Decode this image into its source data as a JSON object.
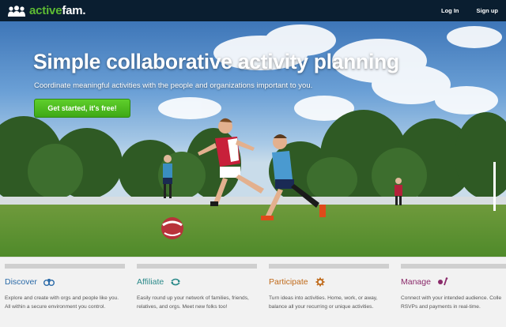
{
  "brand": {
    "name_accent": "active",
    "name_rest": "fam."
  },
  "nav": {
    "login": "Log In",
    "signup": "Sign up"
  },
  "hero": {
    "title": "Simple collaborative activity planning",
    "subtitle": "Coordinate meaningful activities with the people and organizations important to you.",
    "cta": "Get started, it's free!"
  },
  "features": [
    {
      "title": "Discover",
      "color": "#2a6aa8",
      "icon": "binoculars-icon",
      "line1": "Explore and create with orgs and people like you.",
      "line2": "All within a secure environment you control."
    },
    {
      "title": "Affiliate",
      "color": "#2c8a8a",
      "icon": "link-arrows-icon",
      "line1": "Easily round up your network of families, friends,",
      "line2": "relatives, and orgs. Meet new folks too!"
    },
    {
      "title": "Participate",
      "color": "#c06a1a",
      "icon": "gear-icon",
      "line1": "Turn ideas into activities. Home, work, or away,",
      "line2": "balance all your recurring or unique activities."
    },
    {
      "title": "Manage",
      "color": "#8a2a6a",
      "icon": "manage-icon",
      "line1": "Connect with your intended audience. Colle",
      "line2": "RSVPs and payments in real-time."
    }
  ],
  "colors": {
    "brand_green": "#5dbb33",
    "topbar": "#0a1e30",
    "cta_green": "#4bb81f"
  }
}
